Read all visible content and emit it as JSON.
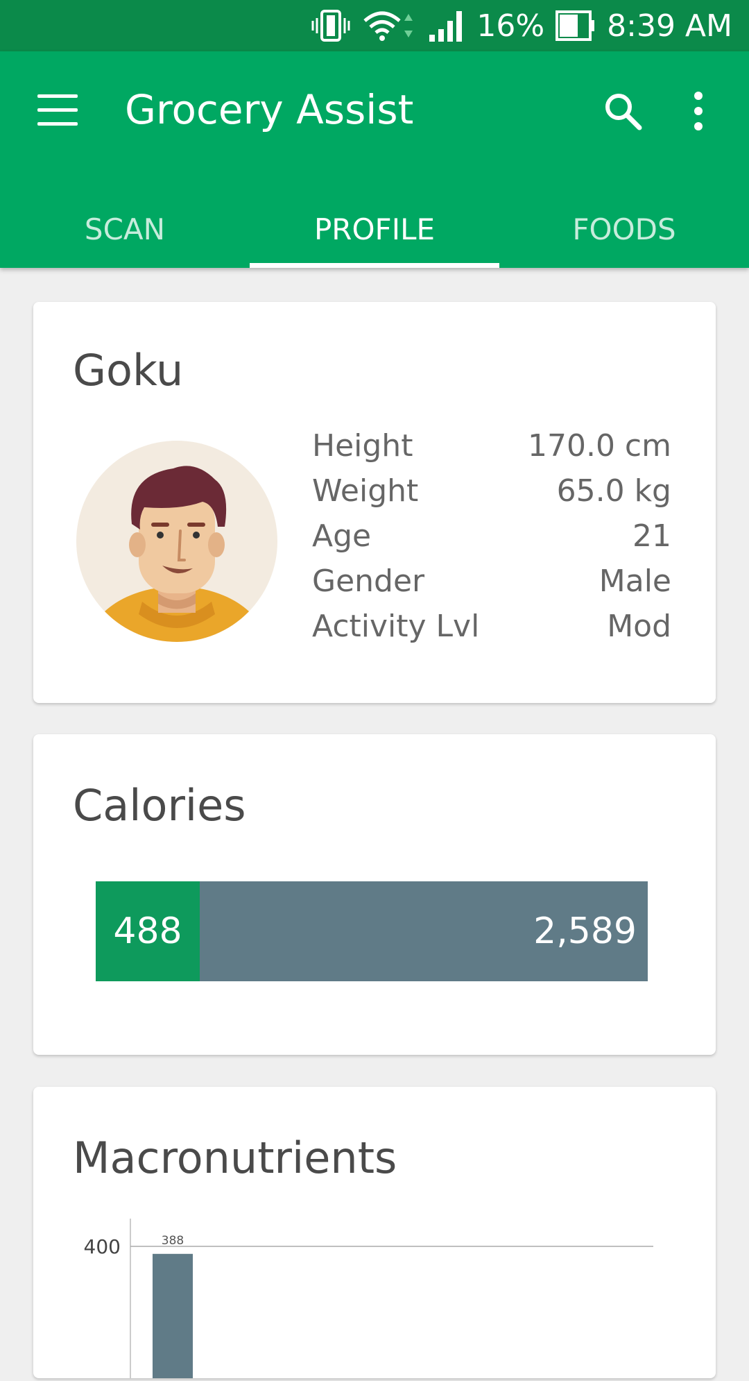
{
  "status_bar": {
    "battery": "16%",
    "time": "8:39 AM",
    "icons": [
      "vibrate-icon",
      "wifi-icon",
      "signal-icon",
      "battery-icon"
    ]
  },
  "app_bar": {
    "title": "Grocery Assist",
    "background": "#00a862",
    "icons": [
      "menu-icon",
      "search-icon",
      "more-vert-icon"
    ]
  },
  "tabs": [
    {
      "label": "SCAN",
      "active": false
    },
    {
      "label": "PROFILE",
      "active": true
    },
    {
      "label": "FOODS",
      "active": false
    }
  ],
  "profile": {
    "name": "Goku",
    "avatar_icon": "user-avatar-icon",
    "stats": [
      {
        "label": "Height",
        "value": "170.0 cm"
      },
      {
        "label": "Weight",
        "value": "65.0 kg"
      },
      {
        "label": "Age",
        "value": "21"
      },
      {
        "label": "Gender",
        "value": "Male"
      },
      {
        "label": "Activity Lvl",
        "value": "Mod"
      }
    ]
  },
  "calories": {
    "title": "Calories",
    "consumed": 488,
    "consumed_label": "488",
    "target": 2589,
    "target_label": "2,589",
    "consumed_color": "#0e9a5c",
    "remaining_color": "#607b87"
  },
  "macronutrients": {
    "title": "Macronutrients"
  },
  "chart_data": {
    "type": "bar",
    "title": "Macronutrients",
    "categories": [
      ""
    ],
    "values": [
      388
    ],
    "data_labels": [
      "388"
    ],
    "y_ticks": [
      400
    ],
    "y_tick_labels": [
      "400"
    ],
    "bar_color": "#607b87",
    "grid": true
  }
}
